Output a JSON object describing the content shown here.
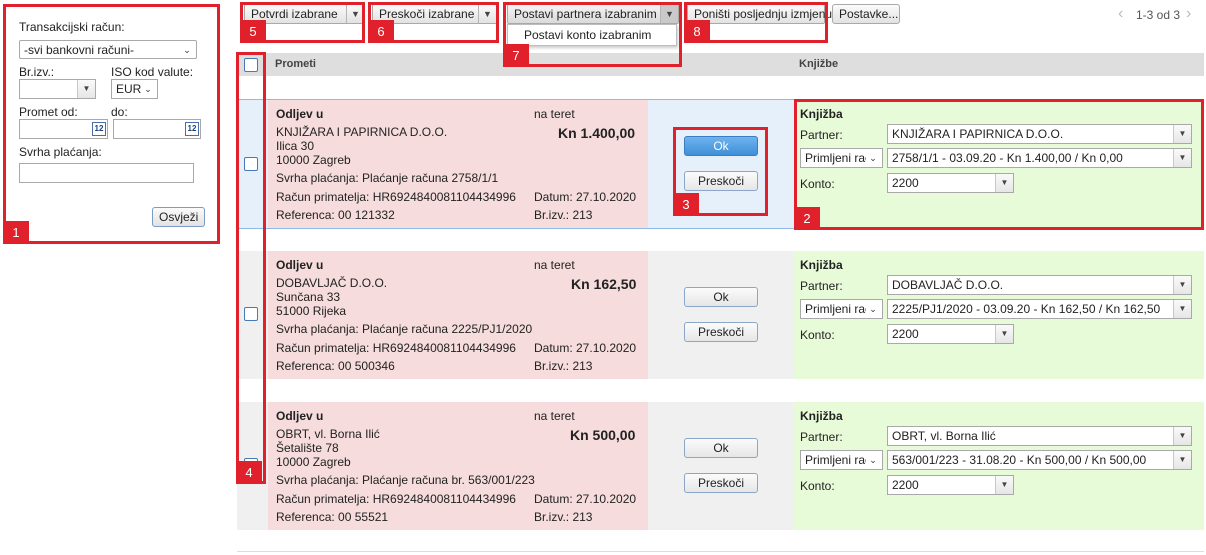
{
  "filter": {
    "account_label": "Transakcijski račun:",
    "account_value": "-svi bankovni računi-",
    "brizv_label": "Br.izv.:",
    "iso_label": "ISO kod valute:",
    "iso_value": "EUR",
    "promet_od_label": "Promet od:",
    "do_label": "do:",
    "svrha_label": "Svrha plaćanja:",
    "refresh_label": "Osvježi",
    "calendar_text": "12"
  },
  "toolbar": {
    "confirm_label": "Potvrdi izabrane",
    "skip_label": "Preskoči izabrane",
    "set_partner_label": "Postavi partnera izabranim",
    "set_konto_label": "Postavi konto izabranim",
    "undo_label": "Poništi posljednju izmjenu",
    "settings_label": "Postavke...",
    "pager_text": "1-3 od 3"
  },
  "table": {
    "col_prometi": "Prometi",
    "col_knjizbe": "Knjižbe"
  },
  "transactions": [
    {
      "type": "Odljev u",
      "direction": "na teret",
      "name": "KNJIŽARA I PAPIRNICA D.O.O.",
      "street": "Ilica 30",
      "city": "10000 Zagreb",
      "amount": "Kn 1.400,00",
      "purpose": "Svrha plaćanja: Plaćanje računa 2758/1/1",
      "account": "Račun primatelja: HR6924840081104434996",
      "date": "Datum: 27.10.2020",
      "reference": "Referenca: 00 121332",
      "brizv": "Br.izv.: 213",
      "ok_label": "Ok",
      "skip_label": "Preskoči",
      "knjizba_title": "Knjižba",
      "partner_label": "Partner:",
      "partner_value": "KNJIŽARA I PAPIRNICA D.O.O.",
      "doc_type": "Primljeni raču",
      "doc_value": "2758/1/1 - 03.09.20 - Kn 1.400,00 / Kn 0,00",
      "konto_label": "Konto:",
      "konto_value": "2200"
    },
    {
      "type": "Odljev u",
      "direction": "na teret",
      "name": "DOBAVLJAČ D.O.O.",
      "street": "Sunčana 33",
      "city": "51000 Rijeka",
      "amount": "Kn 162,50",
      "purpose": "Svrha plaćanja: Plaćanje računa 2225/PJ1/2020",
      "account": "Račun primatelja: HR6924840081104434996",
      "date": "Datum: 27.10.2020",
      "reference": "Referenca: 00 500346",
      "brizv": "Br.izv.: 213",
      "ok_label": "Ok",
      "skip_label": "Preskoči",
      "knjizba_title": "Knjižba",
      "partner_label": "Partner:",
      "partner_value": "DOBAVLJAČ D.O.O.",
      "doc_type": "Primljeni raču",
      "doc_value": "2225/PJ1/2020 - 03.09.20 - Kn 162,50 / Kn 162,50",
      "konto_label": "Konto:",
      "konto_value": "2200"
    },
    {
      "type": "Odljev u",
      "direction": "na teret",
      "name": "OBRT, vl. Borna Ilić",
      "street": "Šetalište 78",
      "city": "10000 Zagreb",
      "amount": "Kn 500,00",
      "purpose": "Svrha plaćanja: Plaćanje računa br. 563/001/223",
      "account": "Račun primatelja: HR6924840081104434996",
      "date": "Datum: 27.10.2020",
      "reference": "Referenca: 00 55521",
      "brizv": "Br.izv.: 213",
      "ok_label": "Ok",
      "skip_label": "Preskoči",
      "knjizba_title": "Knjižba",
      "partner_label": "Partner:",
      "partner_value": "OBRT, vl. Borna Ilić",
      "doc_type": "Primljeni raču",
      "doc_value": "563/001/223 - 31.08.20 - Kn 500,00 / Kn 500,00",
      "konto_label": "Konto:",
      "konto_value": "2200"
    }
  ],
  "annotations": [
    "1",
    "2",
    "3",
    "4",
    "5",
    "6",
    "7",
    "8"
  ],
  "colors": {
    "annotation_red": "#e0202a",
    "pink": "#f6dcdc",
    "green": "#e8fbd9",
    "ok_blue": "#4a9be0"
  }
}
